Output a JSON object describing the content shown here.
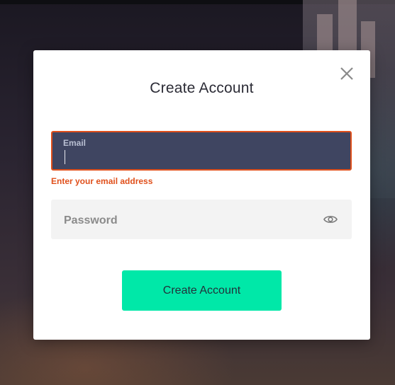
{
  "modal": {
    "title": "Create Account",
    "close_icon": "close-icon"
  },
  "email": {
    "label": "Email",
    "value": "",
    "error": "Enter your email address"
  },
  "password": {
    "placeholder": "Password",
    "value": "",
    "toggle_icon": "eye-icon"
  },
  "submit": {
    "label": "Create Account"
  },
  "colors": {
    "accent": "#00e8a8",
    "error": "#e0501c",
    "email_field_bg": "#3f4561",
    "password_field_bg": "#f3f3f3"
  }
}
